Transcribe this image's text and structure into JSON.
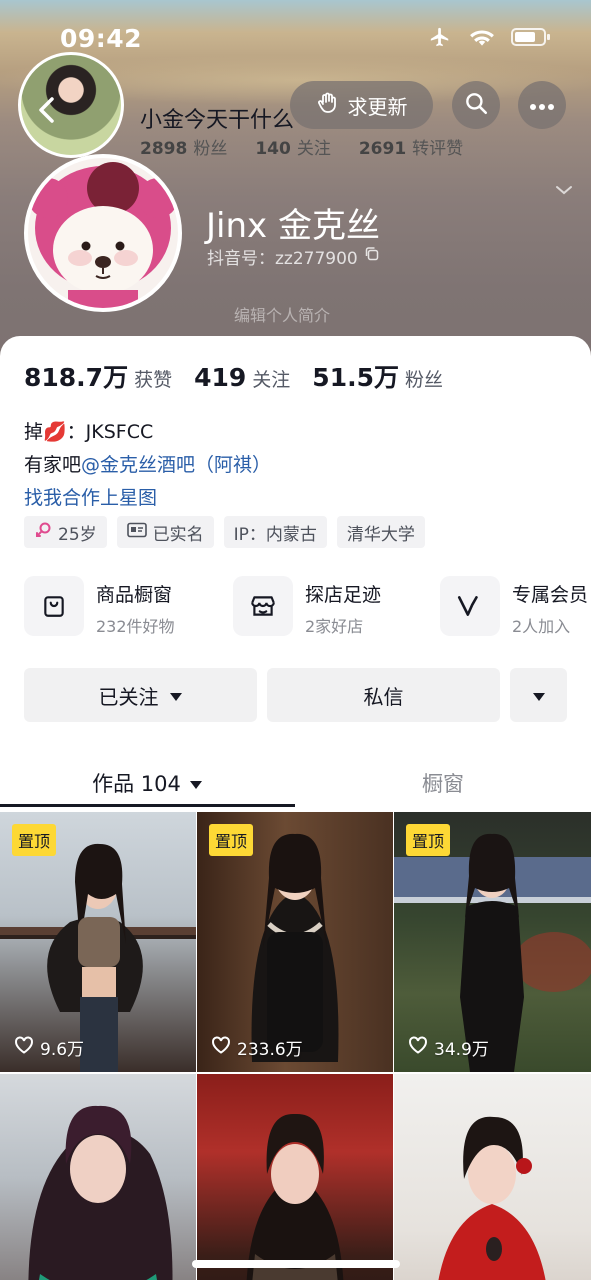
{
  "status": {
    "time": "09:42"
  },
  "mini_header": {
    "name": "小金今天干什么",
    "fans_num": "2898",
    "fans_label": "粉丝",
    "following_num": "140",
    "following_label": "关注",
    "reposts_num": "2691",
    "reposts_label": "转评赞"
  },
  "top_actions": {
    "update_label": "求更新"
  },
  "profile": {
    "name": "Jinx 金克丝",
    "douyin_id": "抖音号：zz277900",
    "edit_hint": "编辑个人简介"
  },
  "counts": [
    {
      "num": "818.7万",
      "label": "获赞"
    },
    {
      "num": "419",
      "label": "关注"
    },
    {
      "num": "51.5万",
      "label": "粉丝"
    }
  ],
  "bio": {
    "line1": "掉💋：JKSFCC",
    "line2_prefix": "有家吧",
    "line2_link": "@金克丝酒吧（阿祺）",
    "line3": "找我合作上星图"
  },
  "tags": [
    {
      "icon": "female-icon",
      "text": "25岁"
    },
    {
      "icon": "id-card-icon",
      "text": "已实名"
    },
    {
      "icon": "",
      "text": "IP：内蒙古"
    },
    {
      "icon": "",
      "text": "清华大学"
    }
  ],
  "features": [
    {
      "icon": "shopping-bag-icon",
      "title": "商品橱窗",
      "sub": "232件好物"
    },
    {
      "icon": "store-icon",
      "title": "探店足迹",
      "sub": "2家好店"
    },
    {
      "icon": "vip-icon",
      "title": "专属会员",
      "sub": "2人加入"
    }
  ],
  "buttons": {
    "followed": "已关注",
    "message": "私信"
  },
  "tabs": {
    "works": "作品 104",
    "window": "橱窗"
  },
  "grid": [
    {
      "pinned": "置顶",
      "likes": "9.6万",
      "bg": "snow"
    },
    {
      "pinned": "置顶",
      "likes": "233.6万",
      "bg": "wood"
    },
    {
      "pinned": "置顶",
      "likes": "34.9万",
      "bg": "garden"
    },
    {
      "pinned": "",
      "likes": "",
      "bg": "winter"
    },
    {
      "pinned": "",
      "likes": "",
      "bg": "red"
    },
    {
      "pinned": "",
      "likes": "",
      "bg": "light"
    }
  ],
  "colors": {
    "link": "#2a5ea8",
    "pin": "#fdd835",
    "accent_text": "#161823"
  }
}
